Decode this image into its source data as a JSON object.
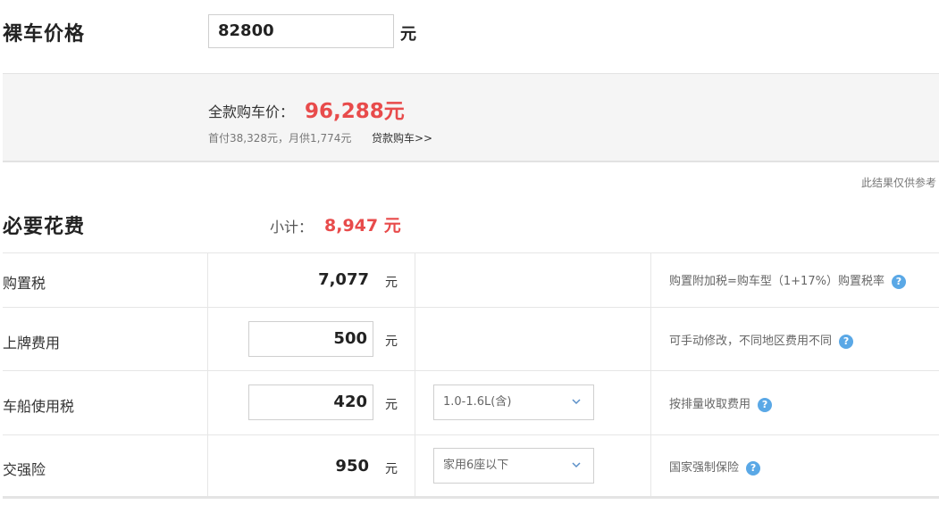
{
  "bare_price": {
    "label": "裸车价格",
    "value": "82800",
    "unit": "元"
  },
  "summary": {
    "full_label": "全款购车价：",
    "full_value": "96,288元",
    "loan_text": "首付38,328元，月供1,774元",
    "loan_link": "贷款购车>>",
    "note": "此结果仅供参考"
  },
  "required": {
    "title": "必要花费",
    "subtotal_label": "小计：",
    "subtotal_value": "8,947 元"
  },
  "rows": [
    {
      "name": "购置税",
      "amount": "7,077",
      "unit": "元",
      "hint": "购置附加税=购车型（1+17%）购置税率"
    },
    {
      "name": "上牌费用",
      "amount": "500",
      "unit": "元",
      "hint": "可手动修改，不同地区费用不同"
    },
    {
      "name": "车船使用税",
      "amount": "420",
      "unit": "元",
      "select": "1.0-1.6L(含)",
      "hint": "按排量收取费用"
    },
    {
      "name": "交强险",
      "amount": "950",
      "unit": "元",
      "select": "家用6座以下",
      "hint": "国家强制保险"
    }
  ],
  "icons": {
    "help": "question-circle-icon",
    "dropdown": "chevron-down-icon"
  },
  "colors": {
    "accent": "#e84b4b",
    "help_icon": "#5aa8e6"
  }
}
